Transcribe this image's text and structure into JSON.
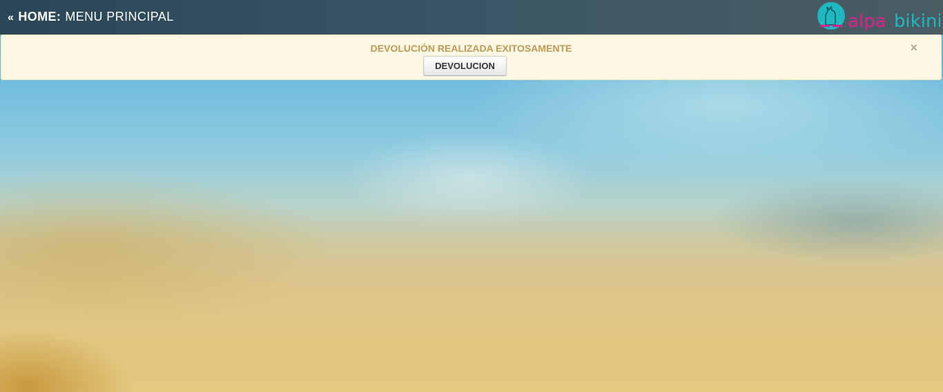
{
  "header": {
    "back_glyph": "«",
    "home_label": "HOME:",
    "title": "MENU PRINCIPAL",
    "logo": {
      "icon": "llama-logo-icon",
      "text_part1": "alpa",
      "text_part2": "bikini",
      "colors": {
        "circle": "#1fb7c0",
        "alpa": "#e0208a",
        "bikini": "#1fb7c0"
      }
    },
    "colors": {
      "bar_start": "#2b4756",
      "bar_end": "#4b5c63",
      "text": "#ffffff"
    }
  },
  "alert": {
    "message": "DEVOLUCIÓN REALIZADA EXITOSAMENTE",
    "close_glyph": "×",
    "button_label": "DEVOLUCION",
    "colors": {
      "background": "#fcf8e3",
      "text": "#c09853"
    }
  }
}
